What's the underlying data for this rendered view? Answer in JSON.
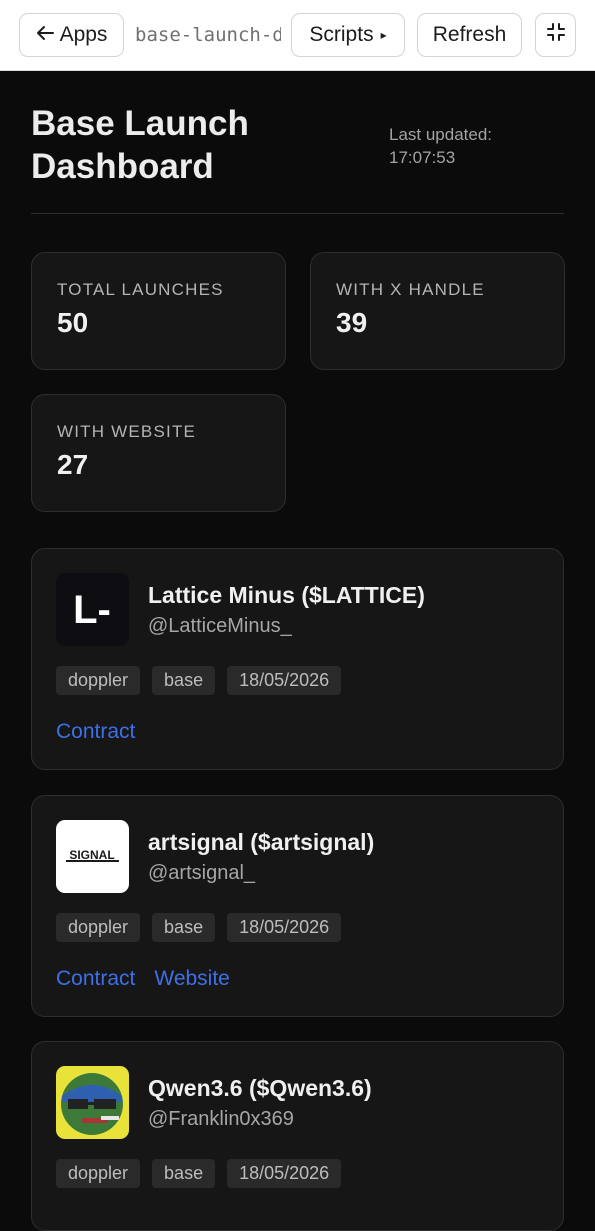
{
  "toolbar": {
    "apps_label": "Apps",
    "path_text": "base-launch-dashboard",
    "scripts_label": "Scripts",
    "refresh_label": "Refresh"
  },
  "header": {
    "title_line1": "Base Launch",
    "title_line2": "Dashboard",
    "updated_label": "Last updated:",
    "updated_time": "17:07:53"
  },
  "stats": [
    {
      "label": "TOTAL LAUNCHES",
      "value": "50"
    },
    {
      "label": "WITH X HANDLE",
      "value": "39"
    },
    {
      "label": "WITH WEBSITE",
      "value": "27"
    }
  ],
  "launches": [
    {
      "name": "Lattice Minus ($LATTICE)",
      "handle": "@LatticeMinus_",
      "avatar_text": "L-",
      "tags": [
        "doppler",
        "base",
        "18/05/2026"
      ],
      "links": [
        "Contract"
      ]
    },
    {
      "name": "artsignal ($artsignal)",
      "handle": "@artsignal_",
      "avatar_text": "SIGNAL",
      "tags": [
        "doppler",
        "base",
        "18/05/2026"
      ],
      "links": [
        "Contract",
        "Website"
      ]
    },
    {
      "name": "Qwen3.6 ($Qwen3.6)",
      "handle": "@Franklin0x369",
      "avatar_text": "",
      "tags": [
        "doppler",
        "base",
        "18/05/2026"
      ],
      "links": []
    }
  ],
  "colors": {
    "background": "#0b0b0b",
    "card": "#161616",
    "link": "#3f6fe6",
    "tag_bg": "#2a2a2a"
  },
  "icons": {
    "back": "arrow-left-icon",
    "scripts": "caret-right-icon",
    "collapse": "collapse-icon"
  }
}
